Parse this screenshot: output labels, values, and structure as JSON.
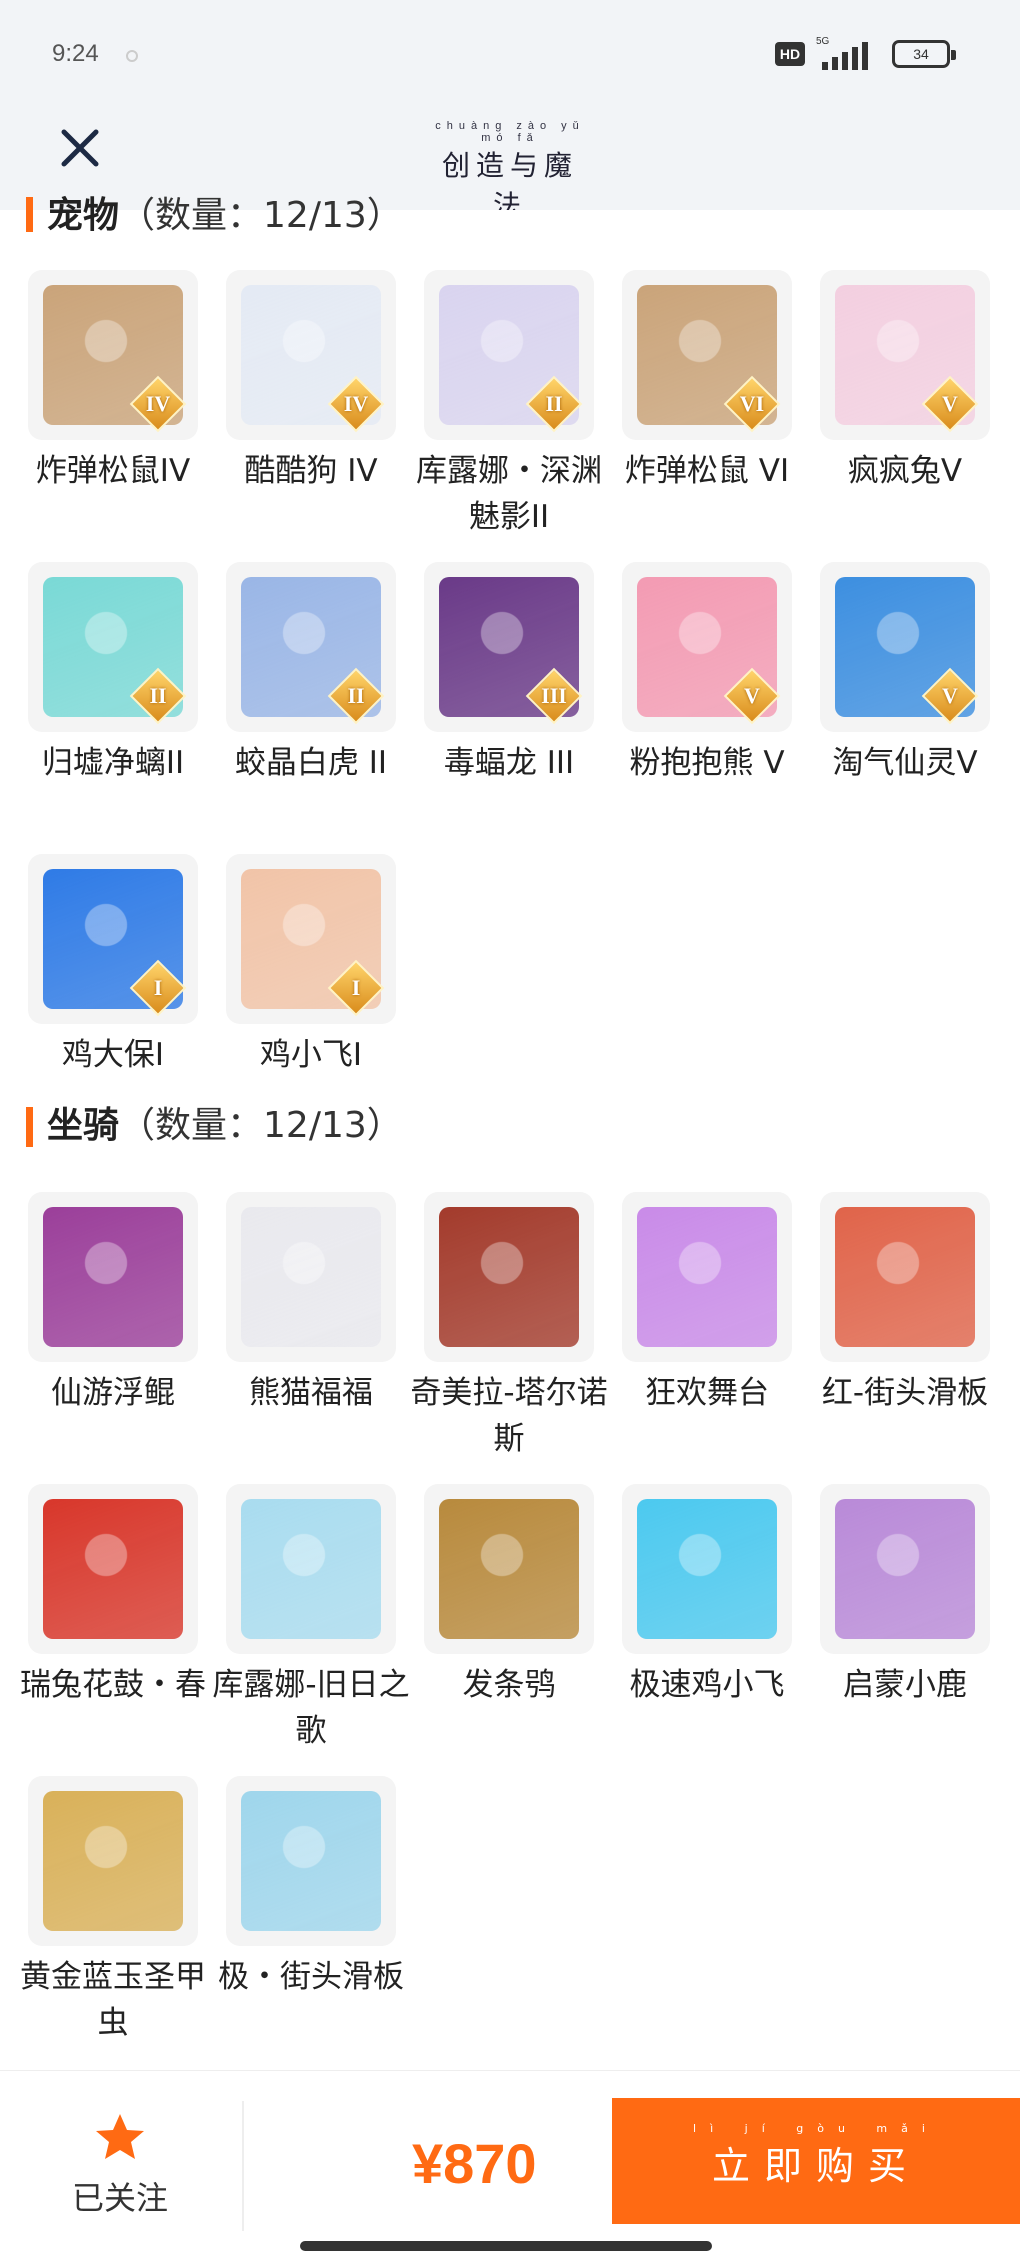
{
  "status_bar": {
    "time": "9:24",
    "hd": "HD",
    "network": "5G",
    "battery": "34"
  },
  "header": {
    "close_icon": "close-icon",
    "title": "创造与魔法",
    "title_ruby": "chuàng zào yǔ mó fǎ"
  },
  "pets_section": {
    "title": "宠物",
    "count_label": "（数量：12/13）"
  },
  "pets": [
    {
      "name": "炸弹松鼠IV",
      "rank": "IV",
      "color": "#caa47a"
    },
    {
      "name": "酷酷狗 IV",
      "rank": "IV",
      "color": "#e4eaf4"
    },
    {
      "name": "库露娜・深渊魅影II",
      "rank": "II",
      "color": "#d9d4ef"
    },
    {
      "name": "炸弹松鼠 VI",
      "rank": "VI",
      "color": "#caa47a"
    },
    {
      "name": "疯疯兔V",
      "rank": "V",
      "color": "#f3cfe0"
    },
    {
      "name": "归墟净螭II",
      "rank": "II",
      "color": "#7ad9d6"
    },
    {
      "name": "蛟晶白虎 II",
      "rank": "II",
      "color": "#9ab6e6"
    },
    {
      "name": "毒蝠龙 III",
      "rank": "III",
      "color": "#6a3a88"
    },
    {
      "name": "粉抱抱熊 V",
      "rank": "V",
      "color": "#f39bb3"
    },
    {
      "name": "淘气仙灵V",
      "rank": "V",
      "color": "#3d8fe0"
    },
    {
      "name": "鸡大保I",
      "rank": "I",
      "color": "#2f7be6"
    },
    {
      "name": "鸡小飞I",
      "rank": "I",
      "color": "#f1c4a8"
    }
  ],
  "mounts_section": {
    "title": "坐骑",
    "count_label": "（数量：12/13）"
  },
  "mounts": [
    {
      "name": "仙游浮鲲",
      "color": "#9b3f9a"
    },
    {
      "name": "熊猫福福",
      "color": "#e9e9ee"
    },
    {
      "name": "奇美拉-塔尔诺斯",
      "color": "#a33b2c"
    },
    {
      "name": "狂欢舞台",
      "color": "#c98be8"
    },
    {
      "name": "红-街头滑板",
      "color": "#e0644a"
    },
    {
      "name": "瑞兔花鼓・春",
      "color": "#d8372b"
    },
    {
      "name": "库露娜-旧日之歌",
      "color": "#a9dcef"
    },
    {
      "name": "发条鸮",
      "color": "#b88a3d"
    },
    {
      "name": "极速鸡小飞",
      "color": "#4cc9ef"
    },
    {
      "name": "启蒙小鹿",
      "color": "#b98ad8"
    },
    {
      "name": "黄金蓝玉圣甲虫",
      "color": "#d9b15a"
    },
    {
      "name": "极・街头滑板",
      "color": "#9fd6ec"
    }
  ],
  "bottom": {
    "fav_label": "已关注",
    "fav_icon": "star-icon",
    "price": "¥870",
    "buy_label": "立即购买",
    "buy_ruby": "lì jí gòu mǎi"
  },
  "colors": {
    "accent": "#ff6a13",
    "header_bg": "#f2f4f7"
  }
}
